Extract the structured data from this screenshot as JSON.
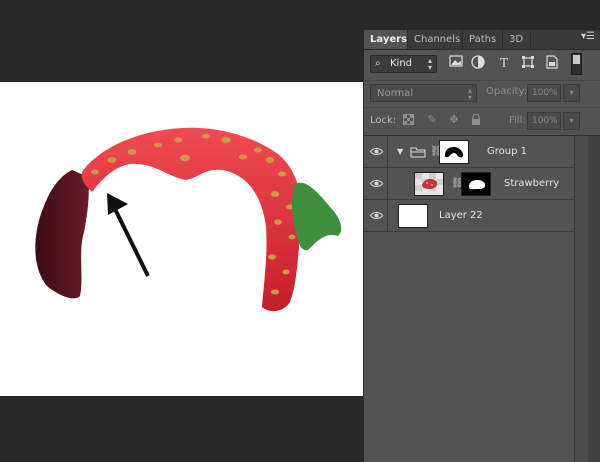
{
  "tabs": [
    {
      "label": "Layers",
      "active": true
    },
    {
      "label": "Channels",
      "active": false
    },
    {
      "label": "Paths",
      "active": false
    },
    {
      "label": "3D",
      "active": false
    }
  ],
  "panel_menu_icon": "panel-menu-icon",
  "filter": {
    "kind_label": "Kind",
    "icons": [
      "pixel-filter-icon",
      "adjustment-filter-icon",
      "type-filter-icon",
      "shape-filter-icon",
      "smart-object-filter-icon"
    ]
  },
  "blend_mode": "Normal",
  "opacity": {
    "label": "Opacity:",
    "value": "100%"
  },
  "lock": {
    "label": "Lock:",
    "icons": [
      "lock-transparent-icon",
      "lock-paint-icon",
      "lock-position-icon",
      "lock-all-icon"
    ]
  },
  "fill": {
    "label": "Fill:",
    "value": "100%"
  },
  "layers": [
    {
      "name": "Group 1",
      "type": "group",
      "visible": true
    },
    {
      "name": "Strawberry",
      "type": "layer",
      "visible": true,
      "indented": true
    },
    {
      "name": "Layer 22",
      "type": "layer",
      "visible": true
    }
  ],
  "colors": {
    "panel_bg": "#535353",
    "workspace_bg": "#282828",
    "canvas_bg": "#ffffff",
    "strawberry_red": "#e0333d",
    "leaf_green": "#3f8f3c",
    "seed": "#c99a4a"
  }
}
